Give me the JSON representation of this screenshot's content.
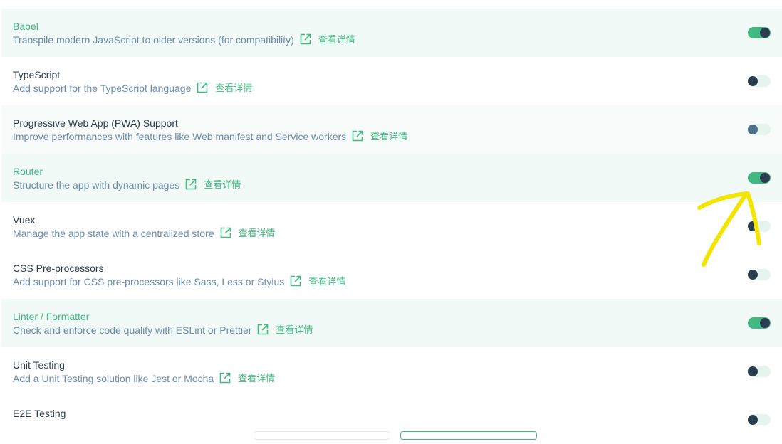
{
  "details_link": "查看详情",
  "colors": {
    "accent": "#42b983",
    "text": "#2c3e50",
    "description": "#6a8bad",
    "selected_background": "#f1faf6",
    "annotation": "#f2e600"
  },
  "icons": {
    "link": "external-link-icon"
  },
  "features": [
    {
      "name": "Babel",
      "description": "Transpile modern JavaScript to older versions (for compatibility)",
      "enabled": true
    },
    {
      "name": "TypeScript",
      "description": "Add support for the TypeScript language",
      "enabled": false
    },
    {
      "name": "Progressive Web App (PWA) Support",
      "description": "Improve performances with features like Web manifest and Service workers",
      "enabled": false
    },
    {
      "name": "Router",
      "description": "Structure the app with dynamic pages",
      "enabled": true
    },
    {
      "name": "Vuex",
      "description": "Manage the app state with a centralized store",
      "enabled": false
    },
    {
      "name": "CSS Pre-processors",
      "description": "Add support for CSS pre-processors like Sass, Less or Stylus",
      "enabled": false
    },
    {
      "name": "Linter / Formatter",
      "description": "Check and enforce code quality with ESLint or Prettier",
      "enabled": true
    },
    {
      "name": "Unit Testing",
      "description": "Add a Unit Testing solution like Jest or Mocha",
      "enabled": false
    },
    {
      "name": "E2E Testing",
      "description": "",
      "enabled": false
    }
  ]
}
